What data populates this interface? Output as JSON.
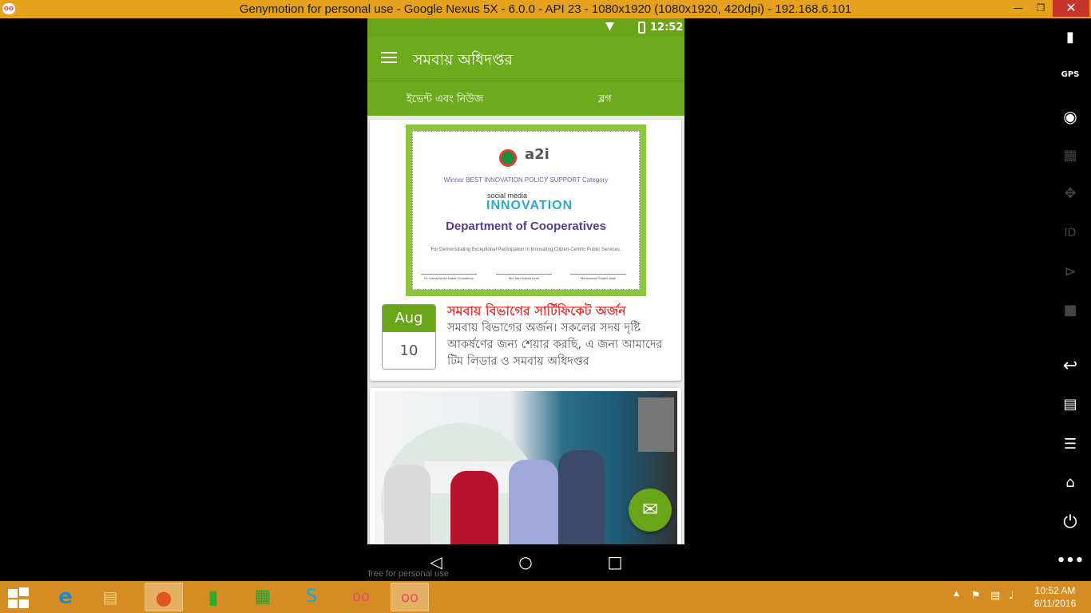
{
  "window": {
    "title": "Genymotion for personal use - Google Nexus 5X - 6.0.0 - API 23 - 1080x1920 (1080x1920, 420dpi) - 192.168.6.101",
    "icon_text": "oo",
    "minimize_icon": "minimize-icon",
    "maximize_icon": "restore-icon",
    "close_icon": "close-icon"
  },
  "status_bar": {
    "time": "12:52"
  },
  "app_bar": {
    "title": "সমবায় অধিদপ্তর"
  },
  "tabs": [
    {
      "label": "ইভেন্ট এবং নিউজ"
    },
    {
      "label": "ব্লগ"
    }
  ],
  "posts": [
    {
      "certificate": {
        "a2i": "a2i",
        "winner": "Winner BEST INNOVATION POLICY SUPPORT Category",
        "social_media": "social media",
        "innovation": "INNOVATION",
        "department": "Department of Cooperatives",
        "for_text": "For Demonstrating Exceptional Participation in Innovating Citizen-Centric Public Services.",
        "signatories": [
          "Dr. Kamal Abdul Naser Chowdhury",
          "Md. Abul Kalam Azad",
          "Mohammad Shafiul Alam"
        ]
      },
      "month": "Aug",
      "day": "10",
      "title": "সমবায় বিভাগের  সার্টিফিকেট অর্জন",
      "excerpt": "সমবায় বিভাগের অর্জন। সকলের সদয় দৃষ্টি আকর্ষণের জন্য শেয়ার করছি, এ জন্য আমাদের টিম লিডার ও সমবায় অধিদপ্তর"
    }
  ],
  "watermark": "free for personal use",
  "taskbar": {
    "clock_time": "10:52 AM",
    "clock_date": "8/11/2016"
  },
  "colors": {
    "primary": "#6eaa1e",
    "accent_red": "#e53935",
    "taskbar": "#d58c22"
  }
}
